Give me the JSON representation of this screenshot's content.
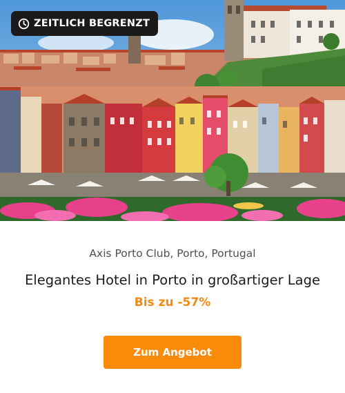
{
  "badge": {
    "label": "ZEITLICH BEGRENZT",
    "icon": "clock-icon"
  },
  "offer": {
    "location": "Axis Porto Club, Porto, Portugal",
    "title": "Elegantes Hotel in Porto in großartiger Lage",
    "discount": "Bis zu -57%",
    "cta_label": "Zum Angebot"
  },
  "colors": {
    "accent": "#f98b0b",
    "discount": "#f28a12",
    "badge_bg": "#1a1a1a"
  }
}
